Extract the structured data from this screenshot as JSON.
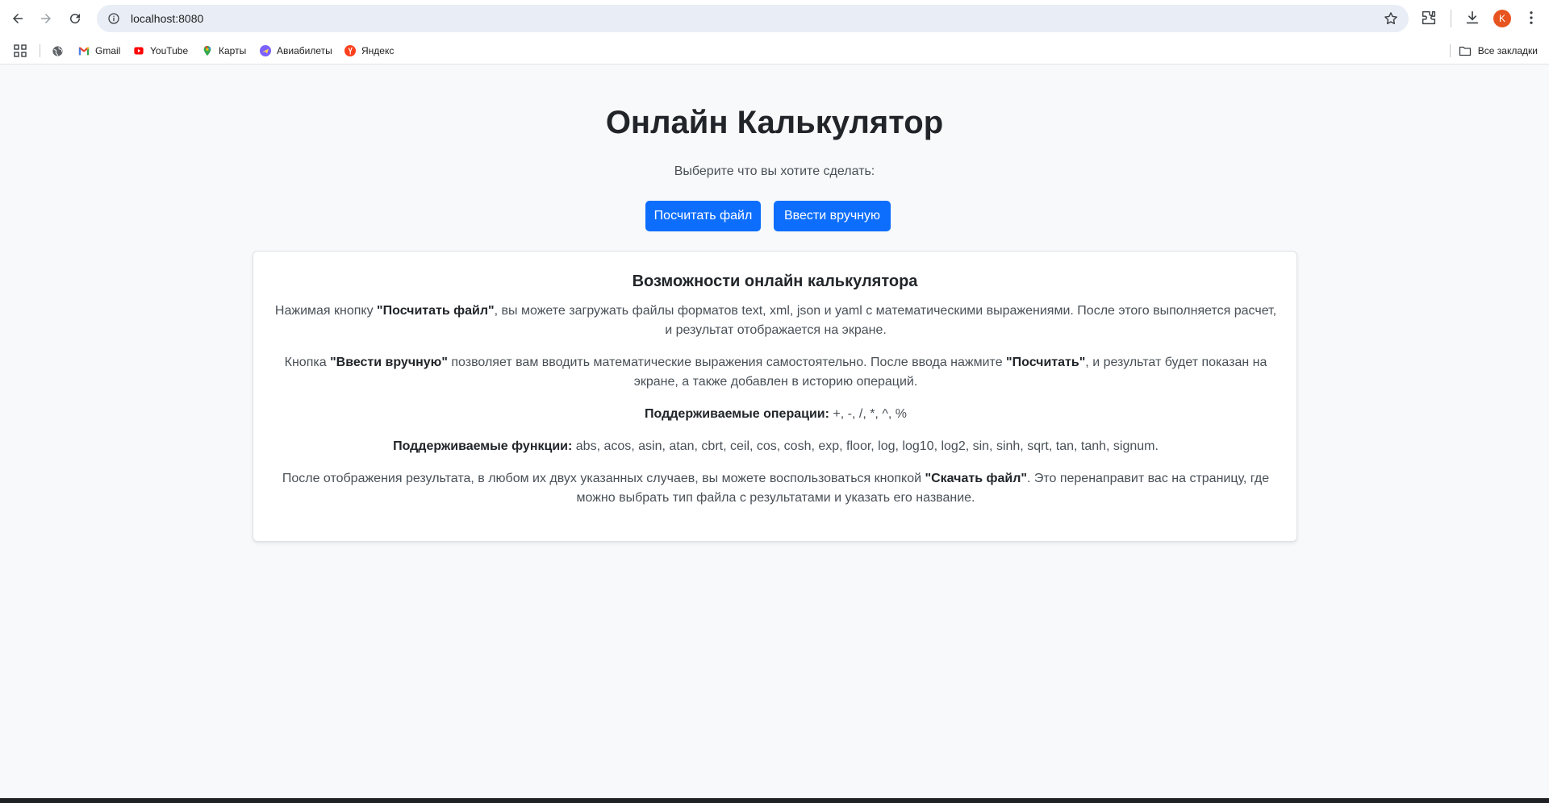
{
  "browser": {
    "url": "localhost:8080",
    "avatar_letter": "K",
    "bookmarks": [
      {
        "label": "Gmail",
        "icon": "gmail-icon"
      },
      {
        "label": "YouTube",
        "icon": "youtube-icon"
      },
      {
        "label": "Карты",
        "icon": "maps-icon"
      },
      {
        "label": "Авиабилеты",
        "icon": "flights-icon"
      },
      {
        "label": "Яндекс",
        "icon": "yandex-icon"
      }
    ],
    "all_bookmarks_label": "Все закладки"
  },
  "page": {
    "title": "Онлайн Калькулятор",
    "subtitle": "Выберите что вы хотите сделать:",
    "buttons": {
      "file": "Посчитать файл",
      "manual": "Ввести вручную"
    },
    "card": {
      "title": "Возможности онлайн калькулятора",
      "p1": {
        "pre": "Нажимая кнопку ",
        "bold": "\"Посчитать файл\"",
        "post": ", вы можете загружать файлы форматов text, xml, json и yaml с математическими выражениями. После этого выполняется расчет, и результат отображается на экране."
      },
      "p2": {
        "pre": "Кнопка ",
        "bold1": "\"Ввести вручную\"",
        "mid": " позволяет вам вводить математические выражения самостоятельно. После ввода нажмите ",
        "bold2": "\"Посчитать\"",
        "post": ", и результат будет показан на экране, а также добавлен в историю операций."
      },
      "p3": {
        "bold": "Поддерживаемые операции:",
        "post": " +, -, /, *, ^, %"
      },
      "p4": {
        "bold": "Поддерживаемые функции:",
        "post": " abs, acos, asin, atan, cbrt, ceil, cos, cosh, exp, floor, log, log10, log2, sin, sinh, sqrt, tan, tanh, signum."
      },
      "p5": {
        "pre": "После отображения результата, в любом их двух указанных случаев, вы можете воспользоваться кнопкой ",
        "bold": "\"Скачать файл\"",
        "post": ". Это перенаправит вас на страницу, где можно выбрать тип файла с результатами и указать его название."
      }
    }
  },
  "colors": {
    "primary": "#0d6efd",
    "page_bg": "#f8f9fa",
    "avatar": "#e8541f"
  }
}
